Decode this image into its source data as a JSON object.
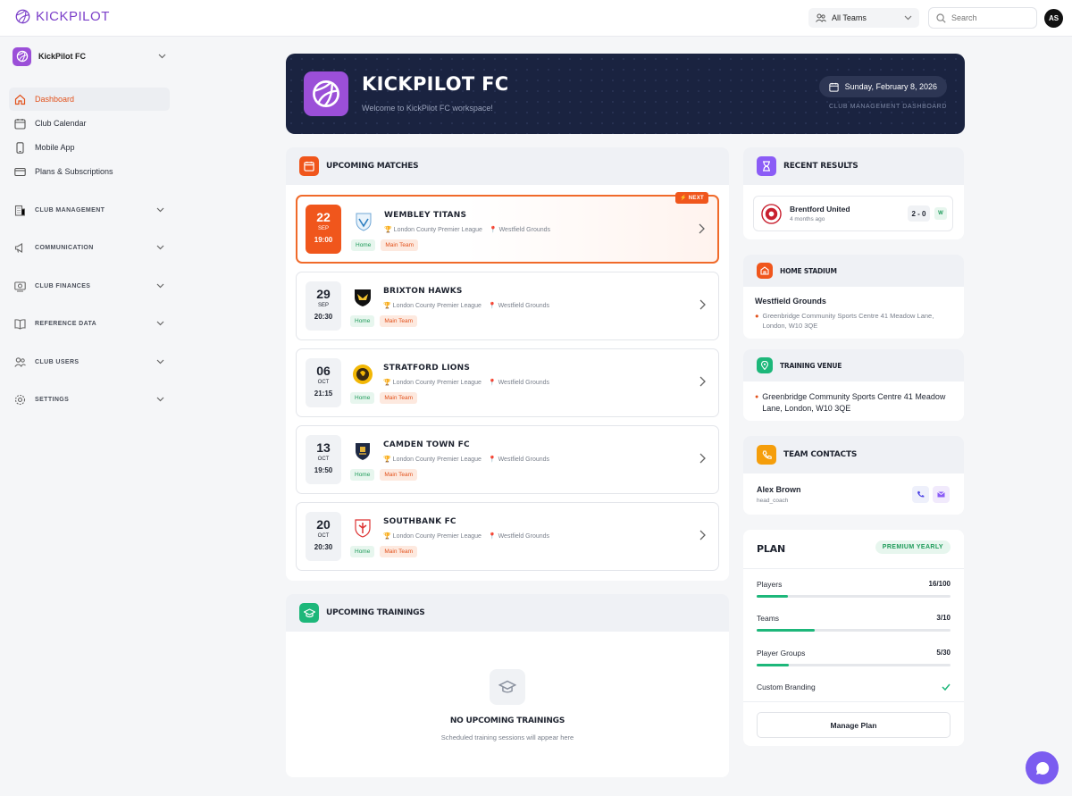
{
  "app": {
    "logo_text": "KICKPILOT"
  },
  "topbar": {
    "team_select": "All Teams",
    "search_placeholder": "Search",
    "avatar_initials": "AS"
  },
  "sidebar": {
    "club_name": "KickPilot FC",
    "items": [
      {
        "label": "Dashboard",
        "icon": "home-icon",
        "active": true
      },
      {
        "label": "Club Calendar",
        "icon": "calendar-icon"
      },
      {
        "label": "Mobile App",
        "icon": "phone-icon"
      },
      {
        "label": "Plans & Subscriptions",
        "icon": "card-icon"
      }
    ],
    "sections": [
      {
        "label": "CLUB MANAGEMENT",
        "icon": "building-icon"
      },
      {
        "label": "COMMUNICATION",
        "icon": "megaphone-icon"
      },
      {
        "label": "CLUB FINANCES",
        "icon": "money-icon"
      },
      {
        "label": "REFERENCE DATA",
        "icon": "book-icon"
      },
      {
        "label": "CLUB USERS",
        "icon": "users-icon"
      },
      {
        "label": "SETTINGS",
        "icon": "gear-icon"
      }
    ]
  },
  "hero": {
    "title": "KICKPILOT FC",
    "subtitle": "Welcome to KickPilot FC workspace!",
    "date": "Sunday, February 8, 2026",
    "tag": "CLUB MANAGEMENT DASHBOARD"
  },
  "matches": {
    "title": "UPCOMING MATCHES",
    "next_label": "⚡ NEXT",
    "items": [
      {
        "day": "22",
        "month": "SEP",
        "time": "19:00",
        "team": "WEMBLEY TITANS",
        "league": "London County Premier League",
        "venue": "Westfield Grounds",
        "tag1": "Home",
        "tag2": "Main Team",
        "next": true
      },
      {
        "day": "29",
        "month": "SEP",
        "time": "20:30",
        "team": "BRIXTON HAWKS",
        "league": "London County Premier League",
        "venue": "Westfield Grounds",
        "tag1": "Home",
        "tag2": "Main Team"
      },
      {
        "day": "06",
        "month": "OCT",
        "time": "21:15",
        "team": "STRATFORD LIONS",
        "league": "London County Premier League",
        "venue": "Westfield Grounds",
        "tag1": "Home",
        "tag2": "Main Team"
      },
      {
        "day": "13",
        "month": "OCT",
        "time": "19:50",
        "team": "CAMDEN TOWN FC",
        "league": "London County Premier League",
        "venue": "Westfield Grounds",
        "tag1": "Home",
        "tag2": "Main Team"
      },
      {
        "day": "20",
        "month": "OCT",
        "time": "20:30",
        "team": "SOUTHBANK FC",
        "league": "London County Premier League",
        "venue": "Westfield Grounds",
        "tag1": "Home",
        "tag2": "Main Team"
      }
    ]
  },
  "trainings": {
    "title": "UPCOMING TRAININGS",
    "empty_title": "NO UPCOMING TRAININGS",
    "empty_sub": "Scheduled training sessions will appear here"
  },
  "results": {
    "title": "RECENT RESULTS",
    "team": "Brentford United",
    "when": "4 months ago",
    "score": "2 - 0",
    "outcome": "W"
  },
  "stadium": {
    "title": "HOME STADIUM",
    "name": "Westfield Grounds",
    "address": "Greenbridge Community Sports Centre 41 Meadow Lane, London, W10 3QE"
  },
  "training_venue": {
    "title": "TRAINING VENUE",
    "address": "Greenbridge Community Sports Centre 41 Meadow Lane, London, W10 3QE"
  },
  "contacts": {
    "title": "TEAM CONTACTS",
    "name": "Alex Brown",
    "role": "head_coach"
  },
  "plan": {
    "title": "PLAN",
    "badge": "PREMIUM YEARLY",
    "rows": [
      {
        "label": "Players",
        "value": "16/100",
        "fraction": 0.16
      },
      {
        "label": "Teams",
        "value": "3/10",
        "fraction": 0.3
      },
      {
        "label": "Player Groups",
        "value": "5/30",
        "fraction": 0.167
      }
    ],
    "branding_label": "Custom Branding",
    "manage_label": "Manage Plan"
  },
  "colors": {
    "accent": "#e2511b",
    "brand": "#9b4fd8",
    "hero_bg": "#1a2340",
    "success": "#1db77a"
  }
}
